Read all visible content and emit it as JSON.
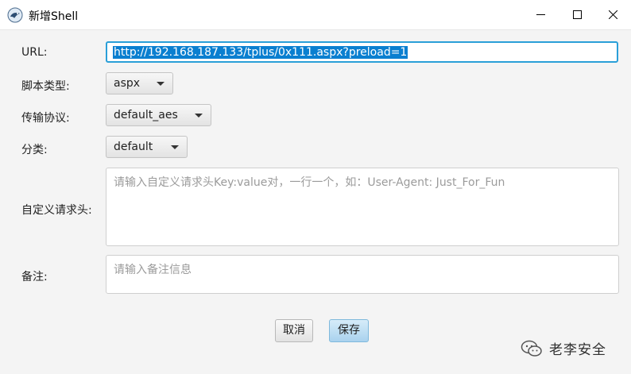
{
  "window": {
    "title": "新增Shell",
    "minimize_icon": "minimize-icon",
    "maximize_icon": "maximize-icon",
    "close_icon": "close-icon"
  },
  "form": {
    "url_label": "URL:",
    "url_value": "http://192.168.187.133/tplus/0x111.aspx?preload=1",
    "script_type_label": "脚本类型:",
    "script_type_value": "aspx",
    "protocol_label": "传输协议:",
    "protocol_value": "default_aes",
    "category_label": "分类:",
    "category_value": "default",
    "headers_label": "自定义请求头:",
    "headers_placeholder": "请输入自定义请求头Key:value对，一行一个，如：User-Agent: Just_For_Fun",
    "remark_label": "备注:",
    "remark_placeholder": "请输入备注信息"
  },
  "buttons": {
    "cancel": "取消",
    "save": "保存"
  },
  "watermark": {
    "text": "老李安全",
    "icon": "wechat-icon"
  },
  "colors": {
    "focus_border": "#2a9fd8",
    "selection": "#0a7fd0",
    "save_button": "#a9d2ee",
    "background": "#f4f4f4"
  }
}
